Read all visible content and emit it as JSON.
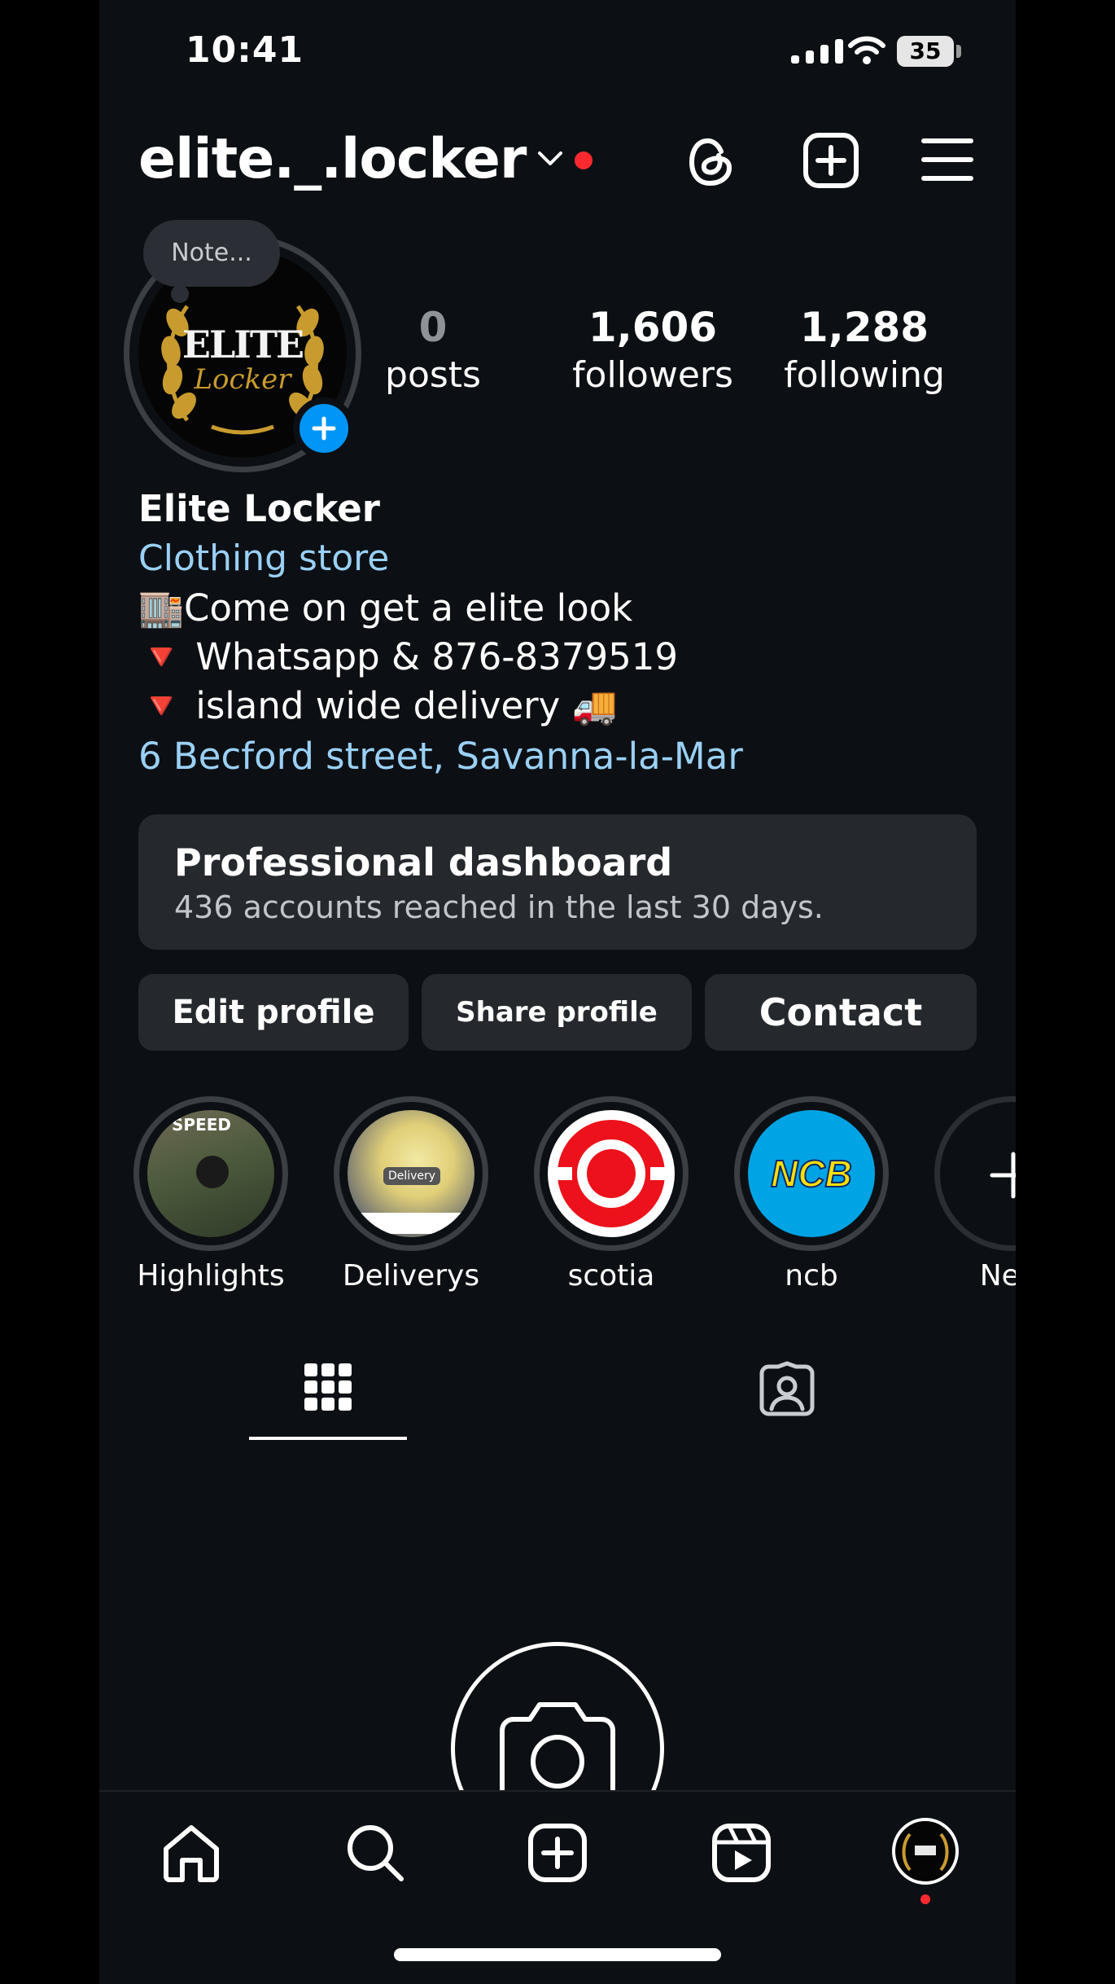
{
  "status_bar": {
    "time": "10:41",
    "battery": "35"
  },
  "header": {
    "username": "elite._.locker"
  },
  "profile": {
    "note_placeholder": "Note...",
    "avatar_logo_line1": "ELITE",
    "avatar_logo_line2": "Locker",
    "stats": [
      {
        "value": "0",
        "label": "posts"
      },
      {
        "value": "1,606",
        "label": "followers"
      },
      {
        "value": "1,288",
        "label": "following"
      }
    ],
    "display_name": "Elite  Locker",
    "category": "Clothing store",
    "bio": [
      "🏬Come on get a elite look",
      "🔻 Whatsapp & 876-8379519",
      "🔻 island wide delivery 🚚"
    ],
    "address": "6 Becford street, Savanna-la-Mar"
  },
  "dashboard": {
    "title": "Professional dashboard",
    "subtitle": "436 accounts reached in the last 30 days."
  },
  "actions": {
    "edit": "Edit profile",
    "share": "Share profile",
    "contact": "Contact"
  },
  "highlights": [
    {
      "label": "Highlights",
      "badge": "SPEED"
    },
    {
      "label": "Deliverys",
      "badge": "Delivery"
    },
    {
      "label": "scotia"
    },
    {
      "label": "ncb",
      "logo": "NCB"
    },
    {
      "label": "New"
    }
  ],
  "colors": {
    "background": "#0c1014",
    "surface": "#25292e",
    "link": "#9ad0f5",
    "accent_blue": "#0095f6",
    "notification_red": "#ff2a2f",
    "scotia_red": "#ec111a",
    "ncb_blue": "#00a4e4",
    "ncb_yellow": "#ffe000"
  },
  "icons": {
    "header": [
      "threads-icon",
      "create-icon",
      "menu-icon"
    ],
    "tabs": [
      "grid-icon",
      "tagged-icon"
    ],
    "nav": [
      "home-icon",
      "search-icon",
      "create-icon",
      "reels-icon",
      "profile-avatar"
    ]
  }
}
